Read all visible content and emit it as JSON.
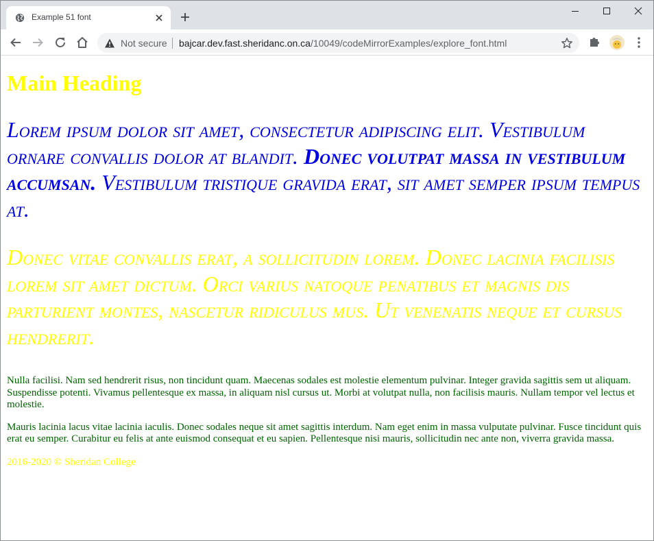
{
  "browser": {
    "tab": {
      "title": "Example 51 font"
    },
    "address": {
      "security": "Not secure",
      "host": "bajcar.dev.fast.sheridanc.on.ca",
      "path": "/10049/codeMirrorExamples/explore_font.html"
    },
    "icons": [
      "globe-icon",
      "close-icon",
      "plus-icon",
      "minimize-icon",
      "maximize-icon",
      "window-close-icon",
      "back-arrow-icon",
      "forward-arrow-icon",
      "reload-icon",
      "home-icon",
      "warning-icon",
      "star-icon",
      "puzzle-icon",
      "avatar",
      "kebab-menu-icon"
    ]
  },
  "page": {
    "heading": "Main Heading",
    "para1": {
      "part1": "Lorem ipsum dolor sit amet, consectetur adipiscing elit. Vestibulum ornare convallis dolor at blandit. ",
      "bold": "Donec volutpat massa in vestibulum accumsan.",
      "part2": " Vestibulum tristique gravida erat, sit amet semper ipsum tempus at."
    },
    "para2": "Donec vitae convallis erat, a sollicitudin lorem. Donec lacinia facilisis lorem sit amet dictum. Orci varius natoque penatibus et magnis dis parturient montes, nascetur ridiculus mus. Ut venenatis neque et cursus hendrerit.",
    "para3": "Nulla facilisi. Nam sed hendrerit risus, non tincidunt quam. Maecenas sodales est molestie elementum pulvinar. Integer gravida sagittis sem ut aliquam. Suspendisse potenti. Vivamus pellentesque ex massa, in aliquam nisl cursus ut. Morbi at volutpat nulla, non facilisis mauris. Nullam tempor vel lectus et molestie.",
    "para4": "Mauris lacinia lacus vitae lacinia iaculis. Donec sodales neque sit amet sagittis interdum. Nam eget enim in massa vulputate pulvinar. Fusce tincidunt quis erat eu semper. Curabitur eu felis at ante euismod consequat et eu sapien. Pellentesque nisi mauris, sollicitudin nec ante non, viverra gravida massa.",
    "footer": "2016-2020 © Sheridan College"
  },
  "colors": {
    "heading": "#ffff00",
    "para1": "#0000e0",
    "para2": "#ffff00",
    "body_text": "#006400",
    "footer": "#ffff00",
    "tabstrip": "#dee1e6",
    "omnibox": "#f1f3f4"
  }
}
